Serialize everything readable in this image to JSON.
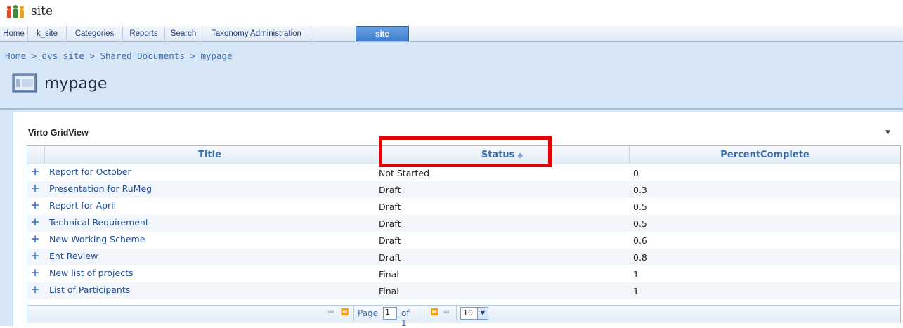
{
  "site": {
    "name": "site"
  },
  "tabs": [
    {
      "label": "Home"
    },
    {
      "label": "k_site"
    },
    {
      "label": "Categories"
    },
    {
      "label": "Reports"
    },
    {
      "label": "Search"
    },
    {
      "label": "Taxonomy Administration"
    },
    {
      "label": "site",
      "active": true
    }
  ],
  "breadcrumb": "Home > dvs site > Shared Documents > mypage",
  "page": {
    "title": "mypage"
  },
  "webpart": {
    "title": "Virto GridView",
    "menu_icon": "caret-down"
  },
  "grid": {
    "columns": [
      "Title",
      "Status",
      "PercentComplete"
    ],
    "sorted_column": "Status",
    "rows": [
      {
        "title": "Report for October",
        "status": "Not Started",
        "percent": "0"
      },
      {
        "title": "Presentation for RuMeg",
        "status": "Draft",
        "percent": "0.3"
      },
      {
        "title": "Report for April",
        "status": "Draft",
        "percent": "0.5"
      },
      {
        "title": "Technical Requirement",
        "status": "Draft",
        "percent": "0.5"
      },
      {
        "title": "New Working Scheme",
        "status": "Draft",
        "percent": "0.6"
      },
      {
        "title": "Ent Review",
        "status": "Draft",
        "percent": "0.8"
      },
      {
        "title": "New list of projects",
        "status": "Final",
        "percent": "1"
      },
      {
        "title": "List of Participants",
        "status": "Final",
        "percent": "1"
      }
    ]
  },
  "pager": {
    "page_label": "Page",
    "page_value": "1",
    "of_label": "of 1",
    "page_size": "10"
  },
  "colors": {
    "accent": "#3f7fcf",
    "highlight": "#e60000",
    "header_bg": "#d6e6f7"
  }
}
